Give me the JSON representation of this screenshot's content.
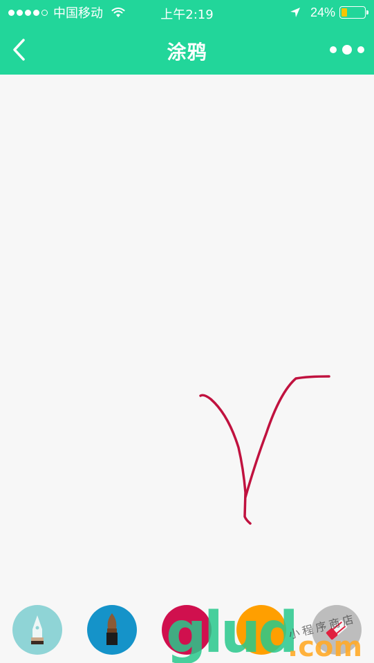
{
  "status_bar": {
    "carrier": "中国移动",
    "time": "上午2:19",
    "battery": "24%",
    "battery_level": 0.24,
    "signal_bars_filled": 4,
    "signal_bars_total": 5
  },
  "nav": {
    "title": "涂鸦",
    "back_icon": "chevron-left-icon",
    "more_icon": "more-dots-icon"
  },
  "colors": {
    "header_bg": "#22d69a",
    "canvas_bg": "#f7f7f7",
    "stroke": "#c0123f",
    "battery_fill": "#f7c500"
  },
  "toolbar": {
    "tools": [
      {
        "name": "pen",
        "icon": "pen-nib-icon",
        "bg": "#8fd4d6"
      },
      {
        "name": "brush",
        "icon": "brush-icon",
        "bg": "#1593c9"
      },
      {
        "name": "color",
        "icon": "color-swatch-icon",
        "bg": "#d0104e"
      },
      {
        "name": "color",
        "icon": "color-swatch-icon",
        "bg": "#ff9f00"
      },
      {
        "name": "eraser",
        "icon": "eraser-icon",
        "bg": "#bdbdbd"
      }
    ]
  },
  "watermark": {
    "main": "glud",
    "suffix": ".com",
    "small": "小程序商店"
  }
}
